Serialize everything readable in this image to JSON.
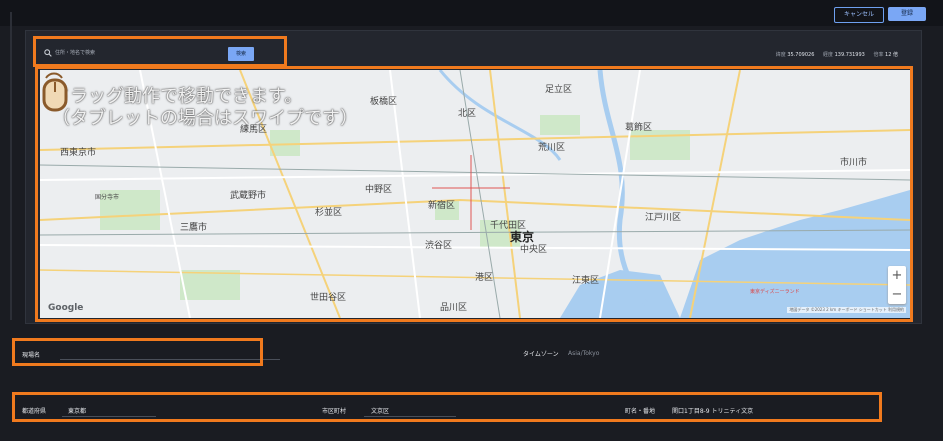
{
  "header": {
    "cancel_label": "キャンセル",
    "register_label": "登録"
  },
  "search": {
    "placeholder": "住所・地名で検索",
    "button_label": "検索"
  },
  "coords": {
    "lat_label": "緯度",
    "lat_value": "35.709026",
    "lng_label": "経度",
    "lng_value": "139.731993",
    "zoom_label": "倍率",
    "zoom_value": "12 倍"
  },
  "map": {
    "caption_line1": "ドラッグ動作で移動できます。",
    "caption_line2": "（タブレットの場合はスワイプです）",
    "labels": {
      "adachi": "足立区",
      "itabashi": "板橋区",
      "kita": "北区",
      "arakawa": "荒川区",
      "katsushika": "葛飾区",
      "nishitokyo": "西東京市",
      "musashino": "武蔵野市",
      "nakano": "中野区",
      "suginami": "杉並区",
      "shinjuku": "新宿区",
      "chiyoda": "千代田区",
      "tokyo": "東京",
      "chuo": "中央区",
      "edogawa": "江戸川区",
      "shibuya": "渋谷区",
      "minato": "港区",
      "koto": "江東区",
      "setagaya": "世田谷区",
      "shinagawa": "品川区",
      "ichikawa": "市川市",
      "kokubunji": "国分寺市",
      "mitaka": "三鷹市",
      "nerima": "練馬区"
    },
    "google": "Google",
    "attribution": "地図データ ©2023  2 km  キーボード ショートカット  利用規約",
    "poi": "東京ディズニーランド",
    "zoom_in": "+",
    "zoom_out": "−"
  },
  "form": {
    "site_name_label": "現場名",
    "timezone_label": "タイムゾーン",
    "timezone_value": "Asia/Tokyo",
    "prefecture_label": "都道府県",
    "prefecture_value": "東京都",
    "city_label": "市区町村",
    "city_value": "文京区",
    "town_label": "町名・番地",
    "town_value": "関口1丁目8-9 トリニティ文京"
  },
  "colors": {
    "highlight": "#f07a1e",
    "accent": "#7aa7f5"
  }
}
